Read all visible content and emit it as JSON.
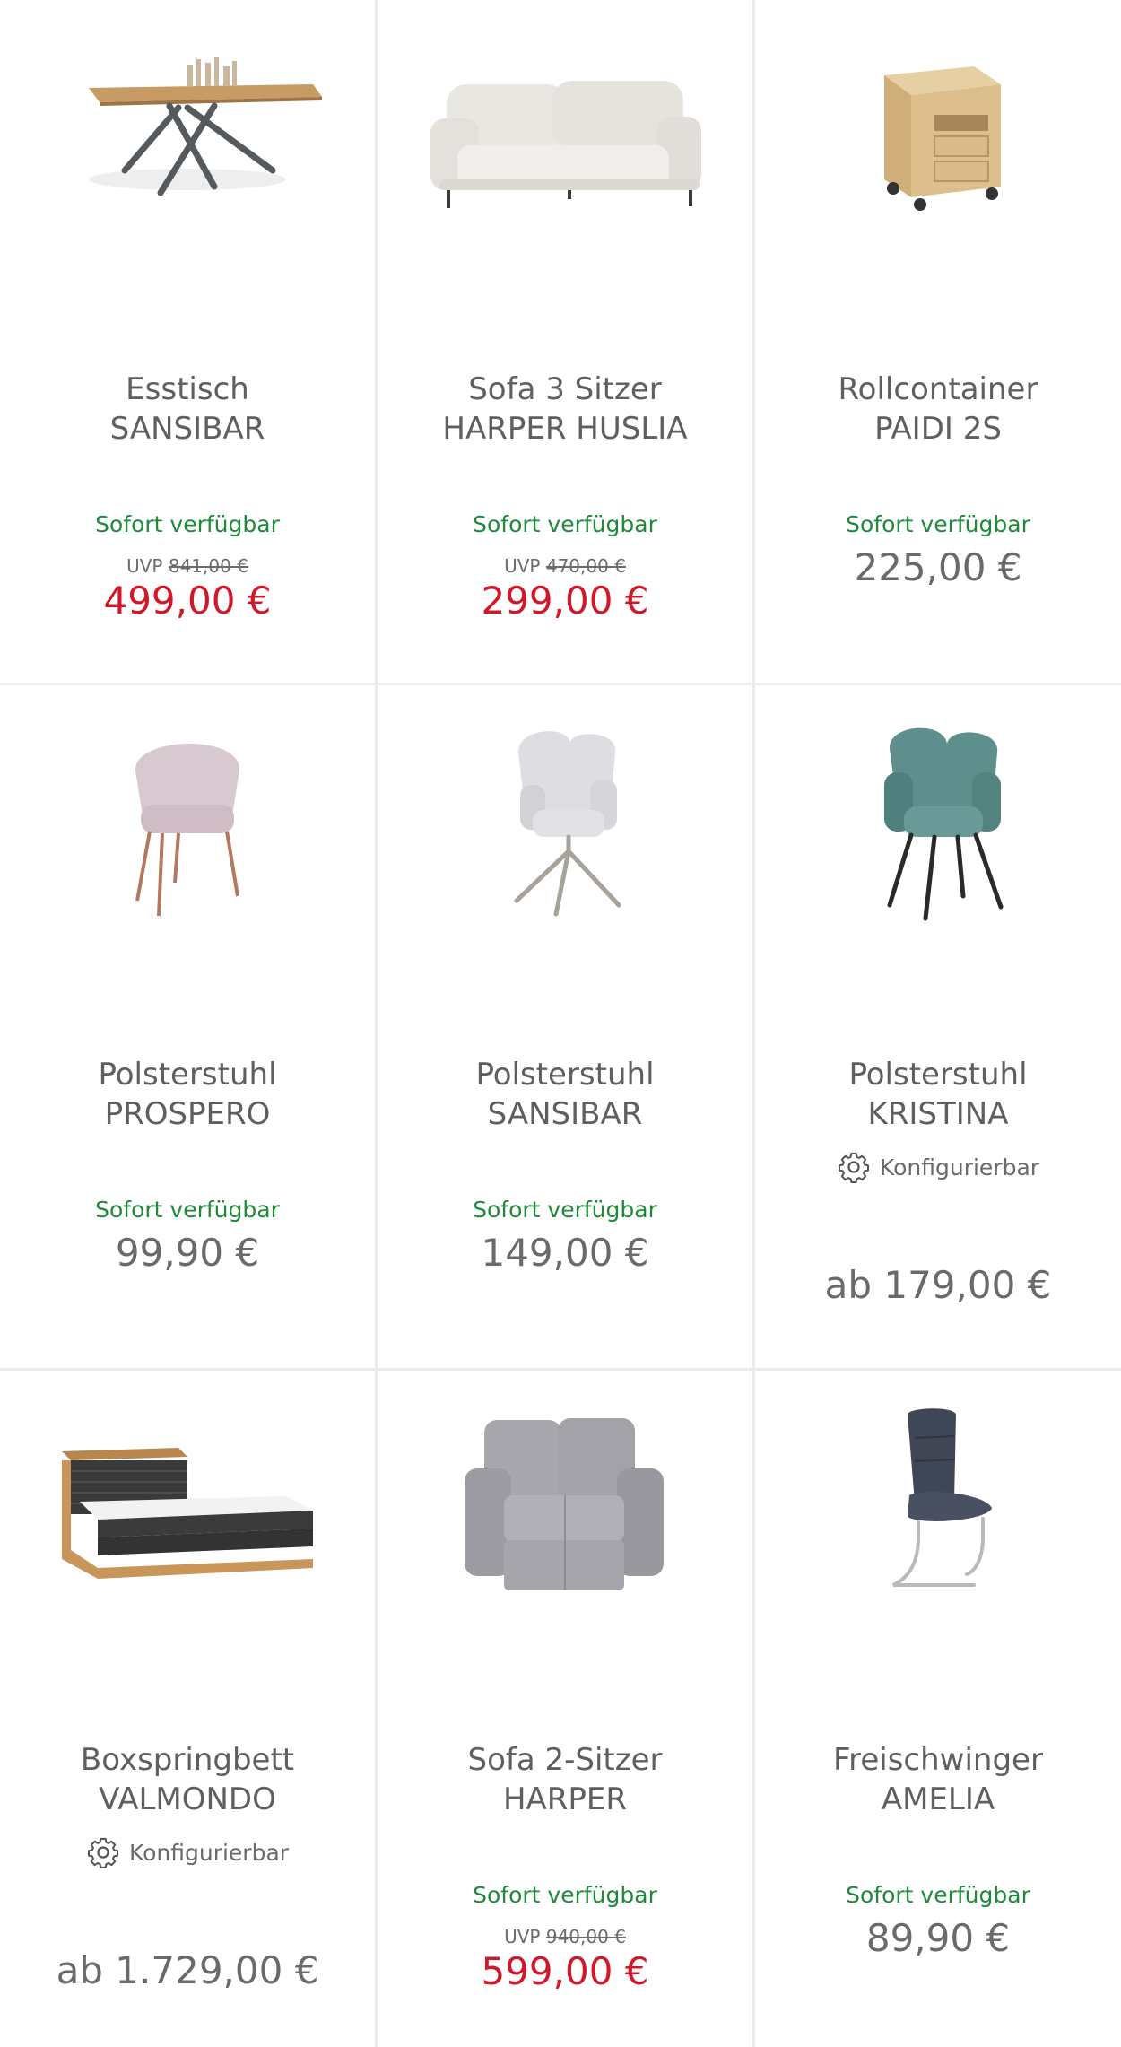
{
  "products": [
    {
      "title_line1": "Esstisch",
      "title_line2": "SANSIBAR",
      "availability": "Sofort verfügbar",
      "uvp_label": "UVP",
      "uvp_price": "841,00 €",
      "price": "499,00 €",
      "image": "dining-table-image"
    },
    {
      "title_line1": "Sofa 3 Sitzer",
      "title_line2": "HARPER HUSLIA",
      "availability": "Sofort verfügbar",
      "uvp_label": "UVP",
      "uvp_price": "470,00 €",
      "price": "299,00 €",
      "image": "sofa-three-seater-image"
    },
    {
      "title_line1": "Rollcontainer",
      "title_line2": "PAIDI 2S",
      "availability": "Sofort verfügbar",
      "price": "225,00 €",
      "image": "rolling-cabinet-image"
    },
    {
      "title_line1": "Polsterstuhl",
      "title_line2": "PROSPERO",
      "availability": "Sofort verfügbar",
      "price": "99,90 €",
      "image": "pink-chair-image"
    },
    {
      "title_line1": "Polsterstuhl",
      "title_line2": "SANSIBAR",
      "availability": "Sofort verfügbar",
      "price": "149,00 €",
      "image": "grey-swivel-chair-image"
    },
    {
      "title_line1": "Polsterstuhl",
      "title_line2": "KRISTINA",
      "configurable": "Konfigurierbar",
      "price": "ab 179,00 €",
      "image": "teal-chair-image"
    },
    {
      "title_line1": "Boxspringbett",
      "title_line2": "VALMONDO",
      "configurable": "Konfigurierbar",
      "price": "ab 1.729,00 €",
      "image": "boxspring-bed-image"
    },
    {
      "title_line1": "Sofa 2-Sitzer",
      "title_line2": "HARPER",
      "availability": "Sofort verfügbar",
      "uvp_label": "UVP",
      "uvp_price": "940,00 €",
      "price": "599,00 €",
      "image": "recliner-sofa-image"
    },
    {
      "title_line1": "Freischwinger",
      "title_line2": "AMELIA",
      "availability": "Sofort verfügbar",
      "price": "89,90 €",
      "image": "cantilever-chair-image"
    }
  ],
  "colors": {
    "availability": "#1f8a3a",
    "sale_price": "#d0182a",
    "regular_price": "#6a6a6a",
    "divider": "#e9ebee"
  }
}
